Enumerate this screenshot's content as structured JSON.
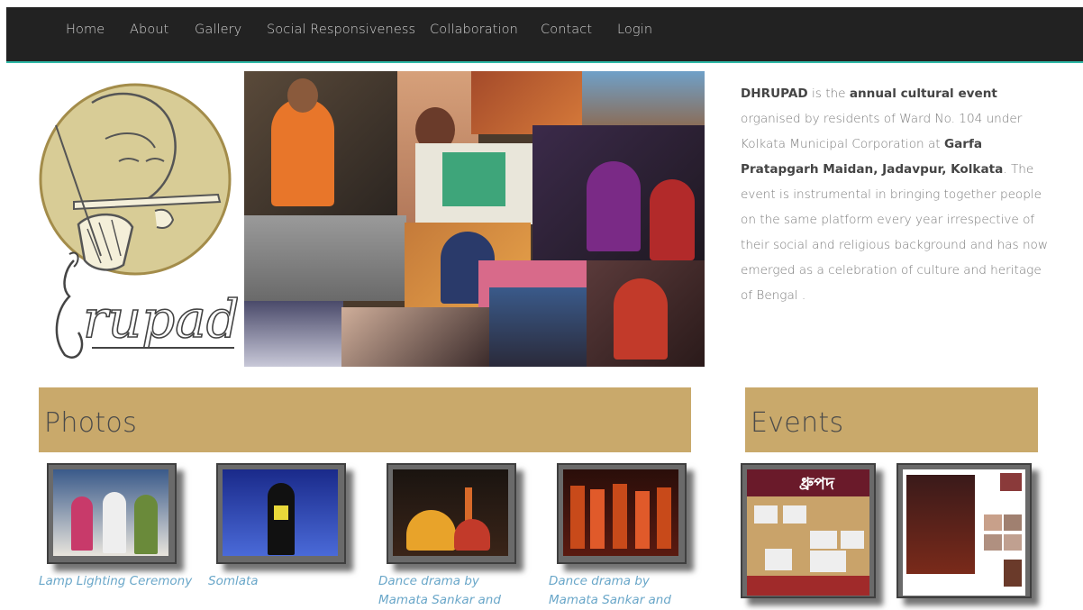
{
  "nav": {
    "items": [
      "Home",
      "About",
      "Gallery",
      "Social Responsiveness",
      "Collaboration",
      "Contact",
      "Login"
    ]
  },
  "logo": {
    "alt_text": "Dhrupad"
  },
  "intro": {
    "brand": "DHRUPAD",
    "t1": " is the ",
    "b1": "annual cultural event",
    "t2": " organised by residents of Ward No. 104 under Kolkata Municipal Corporation at ",
    "b2": "Garfa Pratapgarh Maidan, Jadavpur, Kolkata",
    "t3": ". The event is instrumental in bringing together people on the same platform every year irrespective of their social and religious background and has now emerged as a celebration of culture and heritage of Bengal ."
  },
  "photos": {
    "title": "Photos",
    "items": [
      {
        "caption": "Lamp Lighting Ceremony"
      },
      {
        "caption": "Somlata"
      },
      {
        "caption": "Dance drama by Mamata Sankar and"
      },
      {
        "caption": "Dance drama by Mamata Sankar and"
      }
    ]
  },
  "events": {
    "title": "Events",
    "poster_title": "ধ্রুপদ"
  },
  "colors": {
    "navbar": "#222222",
    "nav_accent": "#2fb8a6",
    "section_bar": "#c9a96b",
    "caption_link": "#6aa7c9"
  }
}
